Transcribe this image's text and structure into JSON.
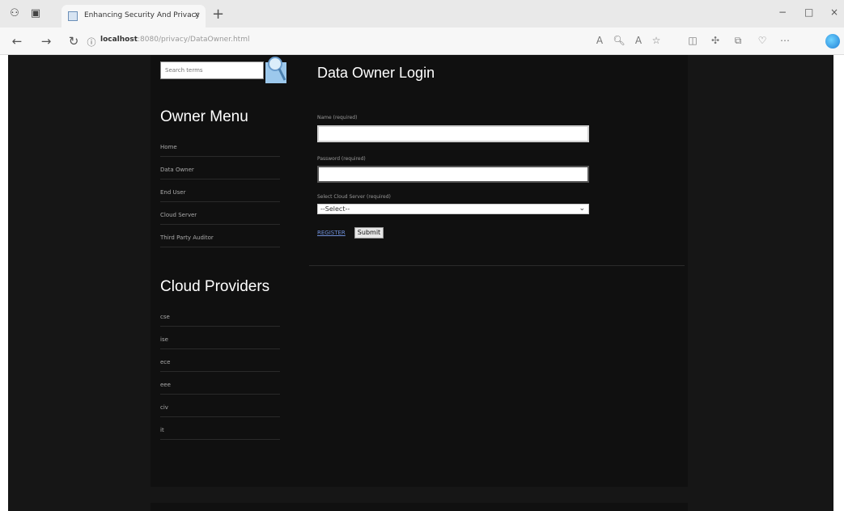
{
  "browser": {
    "tab_title": "Enhancing Security And Privacy",
    "tab_close": "x",
    "new_tab": "+",
    "url_host": "localhost",
    "url_path": ":8080/privacy/DataOwner.html",
    "window_controls": [
      "−",
      "□",
      "×"
    ]
  },
  "sidebar": {
    "search_placeholder": "Search terms",
    "owner_menu_title": "Owner Menu",
    "owner_menu_items": [
      "Home",
      "Data Owner",
      "End User",
      "Cloud Server",
      "Third Party Auditor"
    ],
    "providers_title": "Cloud Providers",
    "providers_items": [
      "cse",
      "ise",
      "ece",
      "eee",
      "civ",
      "it"
    ]
  },
  "main": {
    "title": "Data Owner Login",
    "name_label": "Name (required)",
    "password_label": "Password (required)",
    "cloud_label": "Select Cloud Server (required)",
    "cloud_selected": "--Select--",
    "register_link": "REGISTER",
    "submit_label": "Submit"
  }
}
